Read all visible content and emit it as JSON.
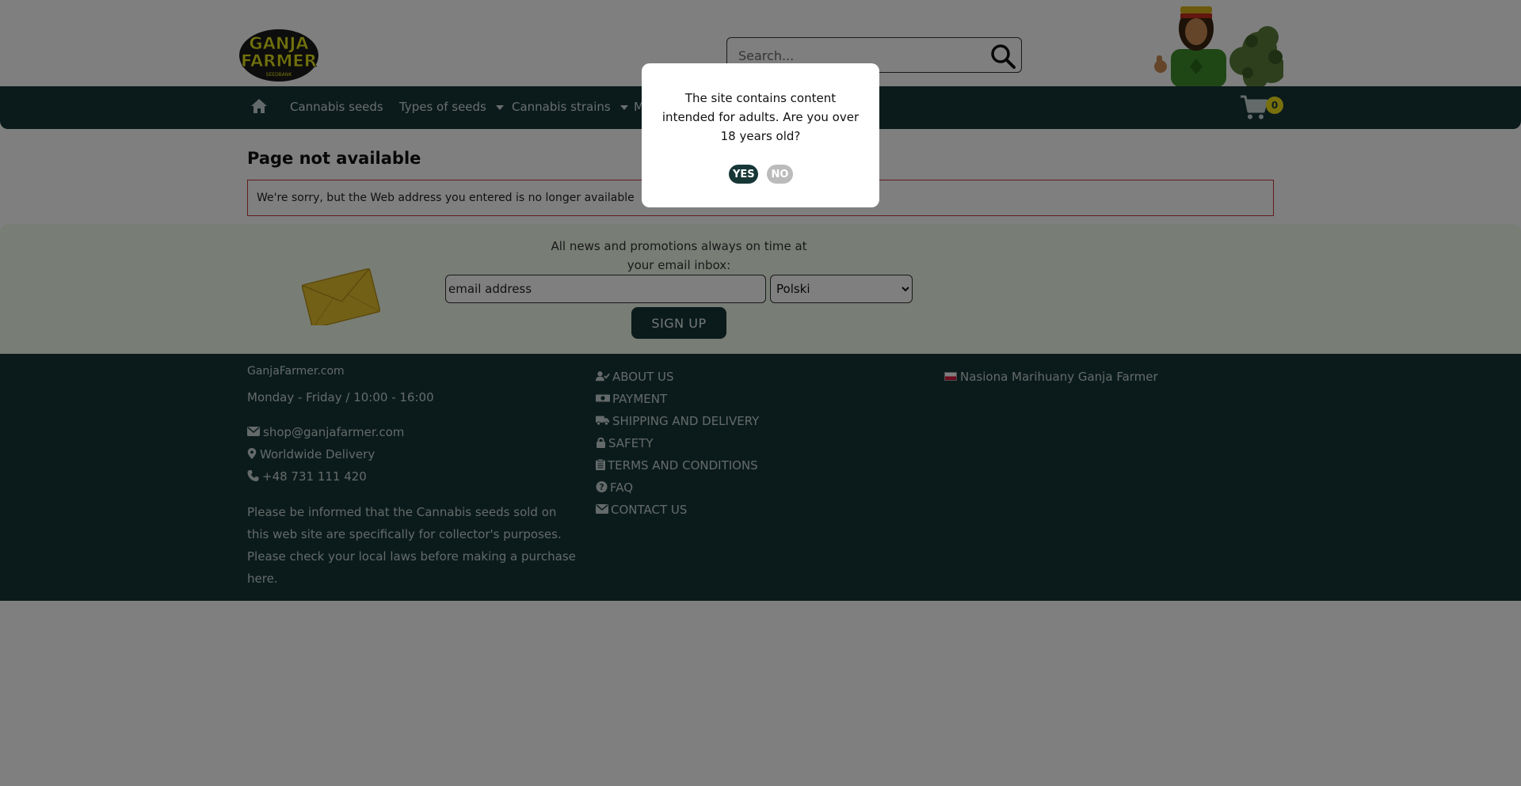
{
  "header": {
    "logo": {
      "line1": "GANJA",
      "line2": "FARMER",
      "line3": "SEEDBANK"
    },
    "search": {
      "placeholder": "Search...",
      "icon": "magnifier-icon"
    }
  },
  "nav": {
    "home_icon": "home-icon",
    "items": [
      {
        "label": "Cannabis seeds",
        "has_dropdown": false
      },
      {
        "label": "Types of seeds",
        "has_dropdown": true
      },
      {
        "label": "Cannabis strains",
        "has_dropdown": true
      },
      {
        "label": "M",
        "has_dropdown": false
      }
    ],
    "cart_count": "0"
  },
  "main": {
    "title": "Page not available",
    "alert": "We're sorry, but the Web address you entered is no longer available"
  },
  "newsletter": {
    "text": "All news and promotions always on time at your email inbox:",
    "email_placeholder": "email address",
    "language_selected": "Polski",
    "signup_label": "SIGN UP"
  },
  "footer": {
    "site": "GanjaFarmer.com",
    "hours": "Monday - Friday / 10:00 - 16:00",
    "email": "shop@ganjafarmer.com",
    "delivery": "Worldwide Delivery",
    "phone": "+48 731 111 420",
    "note": "Please be informed that the Cannabis seeds sold on this web site are specifically for collector's purposes. Please check your local laws before making a purchase here.",
    "links": [
      {
        "label": "ABOUT US",
        "icon": "user-check-icon"
      },
      {
        "label": "PAYMENT",
        "icon": "money-icon"
      },
      {
        "label": "SHIPPING AND DELIVERY",
        "icon": "truck-icon"
      },
      {
        "label": "SAFETY",
        "icon": "lock-icon"
      },
      {
        "label": "TERMS AND CONDITIONS",
        "icon": "clipboard-icon"
      },
      {
        "label": "FAQ",
        "icon": "question-circle-icon"
      },
      {
        "label": "CONTACT US",
        "icon": "envelope-icon"
      }
    ],
    "language_link": "Nasiona Marihuany Ganja Farmer"
  },
  "modal": {
    "text": "The site contains content intended for adults. Are you over 18 years old?",
    "yes_label": "YES",
    "no_label": "NO"
  },
  "colors": {
    "brand_dark": "#173737",
    "accent_yellow": "#f1e11a",
    "alert_border": "#c43a3a",
    "newsletter_bg": "#f1fbea"
  }
}
